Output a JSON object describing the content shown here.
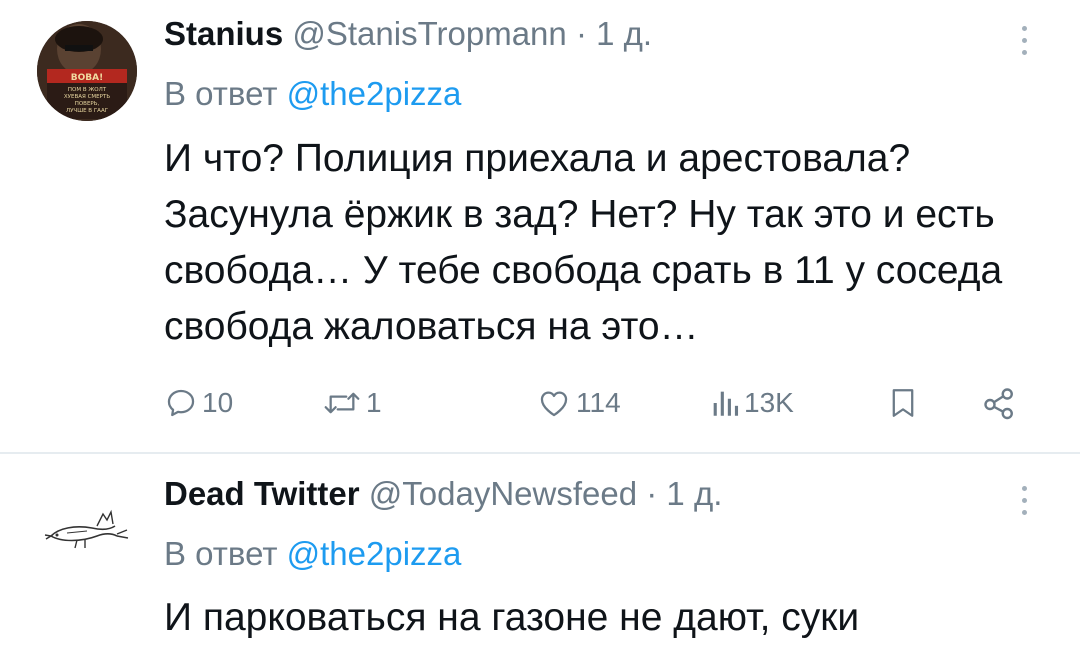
{
  "tweets": [
    {
      "name": "Stanius",
      "handle": "@StanisTropmann",
      "separator": "·",
      "time": "1 д.",
      "reply_prefix": "В ответ",
      "reply_to": "@the2pizza",
      "text": "И что? Полиция приехала и арестовала? Засунула ёржик в зад? Нет? Ну так это и есть свобода… У тебе свобода срать в 11 у соседа свобода жаловаться на это…",
      "avatar_text": [
        "ВОВА!",
        "ПОМ В ЖОЛТ",
        "ХУЕВАЯ СМЕРТЬ",
        "ПОВЕРЬ,",
        "ЛУЧШЕ В ГААГ"
      ],
      "metrics": {
        "replies": "10",
        "reposts": "1",
        "likes": "114",
        "views": "13K"
      }
    },
    {
      "name": "Dead Twitter",
      "handle": "@TodayNewsfeed",
      "separator": "·",
      "time": "1 д.",
      "reply_prefix": "В ответ",
      "reply_to": "@the2pizza",
      "text": "И парковаться на газоне не дают, суки"
    }
  ],
  "colors": {
    "accent": "#1d9bf0",
    "secondary_text": "#6b7a87",
    "divider": "#e6ecf0"
  },
  "icons": [
    "reply-icon",
    "repost-icon",
    "like-icon",
    "views-icon",
    "bookmark-icon",
    "share-icon",
    "more-icon"
  ]
}
